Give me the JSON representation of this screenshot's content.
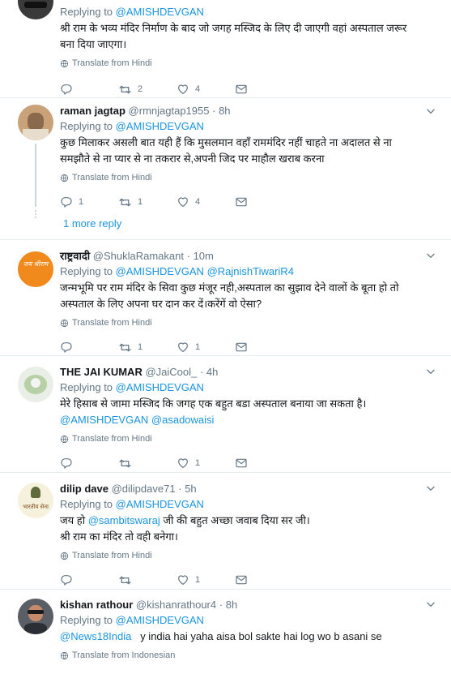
{
  "tweets": [
    {
      "reply_prefix": "Replying to",
      "reply_to": "@AMISHDEVGAN",
      "text_lines": [
        "श्री राम के भव्य मंदिर निर्माण के बाद जो जगह मस्जिद के लिए दी जाएगी वहां अस्पताल जरूर",
        "बना दिया जाएगा।"
      ],
      "translate": "Translate from Hindi",
      "counts": {
        "reply": "",
        "retweet": "2",
        "like": "4"
      }
    },
    {
      "name": "raman jagtap",
      "handle": "@rmnjagtap1955",
      "time": "8h",
      "reply_prefix": "Replying to",
      "reply_to": "@AMISHDEVGAN",
      "text_lines": [
        "कुछ मिलाकर असली बात यही हैं कि मुसलमान वहाँ राममंदिर नहीं चाहते ना अदालत से ना",
        "समझौते से ना प्यार से ना तकरार से,अपनी जिद पर माहौल खराब करना"
      ],
      "translate": "Translate from Hindi",
      "counts": {
        "reply": "1",
        "retweet": "1",
        "like": "4"
      },
      "more_reply": "1 more reply"
    },
    {
      "name": "राष्ट्रवादी",
      "handle": "@ShuklaRamakant",
      "time": "10m",
      "avatar_text": "जय श्रीराम",
      "reply_prefix": "Replying to",
      "reply_to": "@AMISHDEVGAN",
      "reply_to_2": "@RajnishTiwariR4",
      "text_lines": [
        "जन्मभूमि पर राम मंदिर के सिवा कुछ मंजूर नही,अस्पताल का सुझाव देने वालों के बूता हो तो",
        "अस्पताल के लिए अपना घर दान कर दें।करेंगें वो ऐसा?"
      ],
      "translate": "Translate from Hindi",
      "counts": {
        "reply": "",
        "retweet": "1",
        "like": "1"
      }
    },
    {
      "name": "THE JAI KUMAR",
      "handle": "@JaiCool_",
      "time": "4h",
      "reply_prefix": "Replying to",
      "reply_to": "@AMISHDEVGAN",
      "text_lines": [
        "मेरे हिसाब से जामा मस्जिद कि जगह एक बहुत बडा अस्पताल बनाया जा सकता है।"
      ],
      "mention_1": "@AMISHDEVGAN",
      "mention_2": "@asadowaisi",
      "translate": "Translate from Hindi",
      "counts": {
        "reply": "",
        "retweet": "",
        "like": "1"
      }
    },
    {
      "name": "dilip dave",
      "handle": "@dilipdave71",
      "time": "5h",
      "avatar_text": "भारतीय सेना",
      "reply_prefix": "Replying to",
      "reply_to": "@AMISHDEVGAN",
      "line1_pre": "जय हो ",
      "line1_mention": "@sambitswaraj",
      "line1_post": " जी की बहुत अच्छा जवाब दिया सर जी।",
      "line2": "श्री राम का मंदिर तो वही बनेगा।",
      "translate": "Translate from Hindi",
      "counts": {
        "reply": "",
        "retweet": "",
        "like": "1"
      }
    },
    {
      "name": "kishan rathour",
      "handle": "@kishanrathour4",
      "time": "8h",
      "reply_prefix": "Replying to",
      "reply_to": "@AMISHDEVGAN",
      "mention": "@News18India",
      "text_post": "   y india hai yaha aisa bol sakte hai log wo b asani se",
      "translate": "Translate from Indonesian"
    }
  ],
  "dot": "·",
  "colors": {
    "link": "#1b95e0",
    "muted": "#657786",
    "border": "#e6ecf0"
  }
}
